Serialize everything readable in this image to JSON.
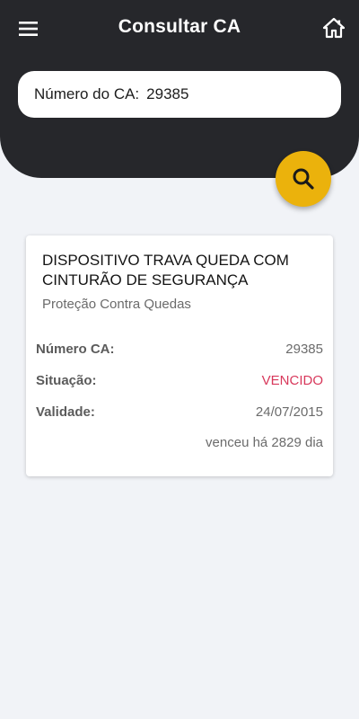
{
  "header": {
    "title": "Consultar CA",
    "menu_icon": "hamburger-menu-icon",
    "home_icon": "home-icon",
    "background_color": "#26272b"
  },
  "search": {
    "label": "Número do CA:",
    "value": "29385",
    "button_icon": "search-icon",
    "button_color": "#ebb20c"
  },
  "result": {
    "title": "DISPOSITIVO TRAVA QUEDA COM CINTURÃO DE SEGURANÇA",
    "category": "Proteção Contra Quedas",
    "fields": {
      "numero_label": "Número CA:",
      "numero_value": "29385",
      "situacao_label": "Situação:",
      "situacao_value": "VENCIDO",
      "situacao_color": "#d8385b",
      "validade_label": "Validade:",
      "validade_value": "24/07/2015"
    },
    "note": "venceu há 2829 dia"
  }
}
